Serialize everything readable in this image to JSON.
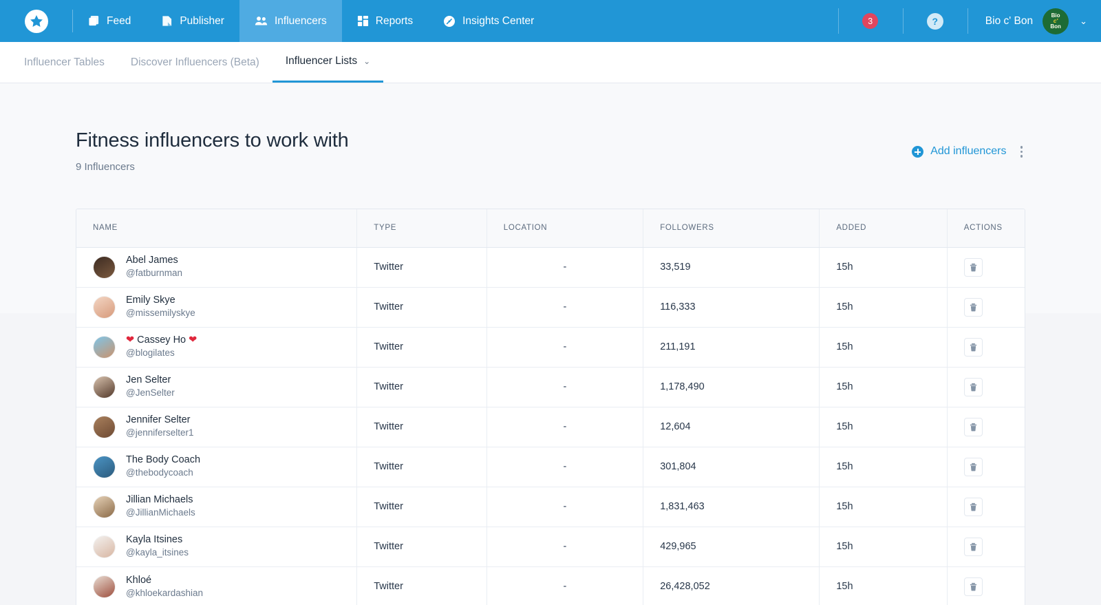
{
  "header": {
    "logo": "star-logo",
    "nav": [
      {
        "label": "Feed",
        "icon": "feed-icon",
        "active": false
      },
      {
        "label": "Publisher",
        "icon": "publisher-icon",
        "active": false
      },
      {
        "label": "Influencers",
        "icon": "influencers-icon",
        "active": true
      },
      {
        "label": "Reports",
        "icon": "reports-icon",
        "active": false
      },
      {
        "label": "Insights Center",
        "icon": "insights-icon",
        "active": false
      }
    ],
    "notification_count": "3",
    "help_label": "?",
    "user_name": "Bio c' Bon",
    "avatar_lines": [
      "Bio",
      "c'",
      "Bon"
    ],
    "caret": "⌄",
    "brand_color": "#2196d6",
    "active_tab_color": "#4fabe2",
    "badge_color": "#e0465e",
    "avatar_color": "#1d6b34"
  },
  "subnav": {
    "items": [
      {
        "label": "Influencer Tables",
        "active": false,
        "caret": ""
      },
      {
        "label": "Discover Influencers (Beta)",
        "active": false,
        "caret": ""
      },
      {
        "label": "Influencer Lists",
        "active": true,
        "caret": "⌄"
      }
    ]
  },
  "page": {
    "title": "Fitness influencers to work with",
    "subtitle": "9 Influencers",
    "add_label": "Add influencers",
    "add_icon": "plus-circle-icon",
    "kebab_icon": "more-vertical-icon"
  },
  "table": {
    "columns": [
      "NAME",
      "TYPE",
      "LOCATION",
      "FOLLOWERS",
      "ADDED",
      "ACTIONS"
    ],
    "delete_icon": "trash-icon",
    "rows": [
      {
        "name": "Abel James",
        "handle": "@fatburnman",
        "type": "Twitter",
        "location": "-",
        "followers": "33,519",
        "added": "15h",
        "av1": "#3c2b22",
        "av2": "#7c5a3f"
      },
      {
        "name": "Emily Skye",
        "handle": "@missemilyskye",
        "type": "Twitter",
        "location": "-",
        "followers": "116,333",
        "added": "15h",
        "av1": "#f3d6c4",
        "av2": "#d79a7b"
      },
      {
        "name": "❤ Cassey Ho ❤",
        "handle": "@blogilates",
        "type": "Twitter",
        "location": "-",
        "followers": "211,191",
        "added": "15h",
        "av1": "#7fc5e8",
        "av2": "#c9936e"
      },
      {
        "name": "Jen Selter",
        "handle": "@JenSelter",
        "type": "Twitter",
        "location": "-",
        "followers": "1,178,490",
        "added": "15h",
        "av1": "#d8c2ae",
        "av2": "#53392a"
      },
      {
        "name": "Jennifer Selter",
        "handle": "@jenniferselter1",
        "type": "Twitter",
        "location": "-",
        "followers": "12,604",
        "added": "15h",
        "av1": "#a9805d",
        "av2": "#6e4a33"
      },
      {
        "name": "The Body Coach",
        "handle": "@thebodycoach",
        "type": "Twitter",
        "location": "-",
        "followers": "301,804",
        "added": "15h",
        "av1": "#4b94c4",
        "av2": "#2c5b7d"
      },
      {
        "name": "Jillian Michaels",
        "handle": "@JillianMichaels",
        "type": "Twitter",
        "location": "-",
        "followers": "1,831,463",
        "added": "15h",
        "av1": "#e6d2b8",
        "av2": "#8b6a47"
      },
      {
        "name": "Kayla Itsines",
        "handle": "@kayla_itsines",
        "type": "Twitter",
        "location": "-",
        "followers": "429,965",
        "added": "15h",
        "av1": "#f3f1ef",
        "av2": "#d8b6a2"
      },
      {
        "name": "Khloé",
        "handle": "@khloekardashian",
        "type": "Twitter",
        "location": "-",
        "followers": "26,428,052",
        "added": "15h",
        "av1": "#e8dcd2",
        "av2": "#9e4f3e"
      }
    ]
  }
}
